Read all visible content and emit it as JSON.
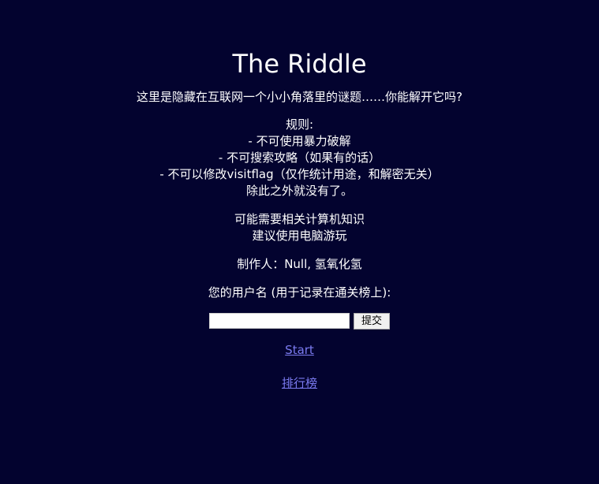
{
  "page": {
    "title": "The Riddle",
    "intro": "这里是隐藏在互联网一个小小角落里的谜题……你能解开它吗?",
    "rules_heading": "规则:",
    "rules": [
      "- 不可使用暴力破解",
      "- 不可搜索攻略（如果有的话）",
      "- 不可以修改visitflag（仅作统计用途，和解密无关）"
    ],
    "rules_footer": "除此之外就没有了。",
    "hint_line1": "可能需要相关计算机知识",
    "hint_line2": "建议使用电脑游玩",
    "author": "制作人：Null, 氢氧化氢",
    "username_label": "您的用户名 (用于记录在通关榜上):"
  },
  "form": {
    "username_value": "",
    "submit_label": "提交"
  },
  "links": {
    "start": "Start",
    "leaderboard": "排行榜"
  },
  "colors": {
    "background": "#03032f",
    "text": "#ffffff",
    "link": "#7b7bf0"
  }
}
